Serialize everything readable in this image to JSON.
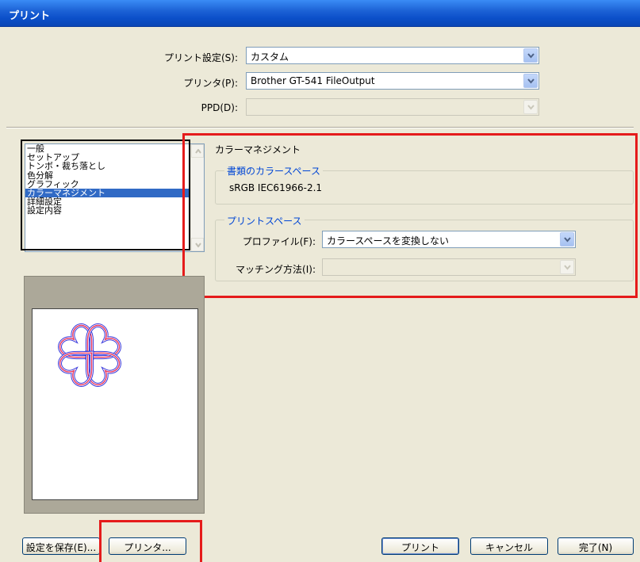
{
  "window": {
    "title": "プリント"
  },
  "top_settings": {
    "preset_label": "プリント設定(S):",
    "preset_value": "カスタム",
    "printer_label": "プリンタ(P):",
    "printer_value": "Brother GT-541 FileOutput",
    "ppd_label": "PPD(D):",
    "ppd_value": ""
  },
  "category_list": {
    "items": [
      "一般",
      "セットアップ",
      "トンボ・裁ち落とし",
      "色分解",
      "グラフィック",
      "カラーマネジメント",
      "詳細設定",
      "設定内容"
    ],
    "selected": "カラーマネジメント"
  },
  "color_management": {
    "title": "カラーマネジメント",
    "document_space_legend": "書類のカラースペース",
    "document_space_value": "sRGB IEC61966-2.1",
    "print_space_legend": "プリントスペース",
    "profile_label": "プロファイル(F):",
    "profile_value": "カラースペースを変換しない",
    "matching_label": "マッチング方法(I):",
    "matching_value": ""
  },
  "buttons": {
    "save_settings": "設定を保存(E)...",
    "printer": "プリンタ...",
    "print": "プリント",
    "cancel": "キャンセル",
    "done": "完了(N)"
  },
  "colors": {
    "title_bar": "#0a4fc9",
    "selection": "#316ac5",
    "group_legend": "#0046d5",
    "highlight_box": "#e51b1b",
    "heart_blue": "#3a3adb",
    "heart_red": "#e8365f"
  },
  "icons": [
    "chevron-down-icon",
    "scroll-up-icon",
    "scroll-down-icon"
  ]
}
